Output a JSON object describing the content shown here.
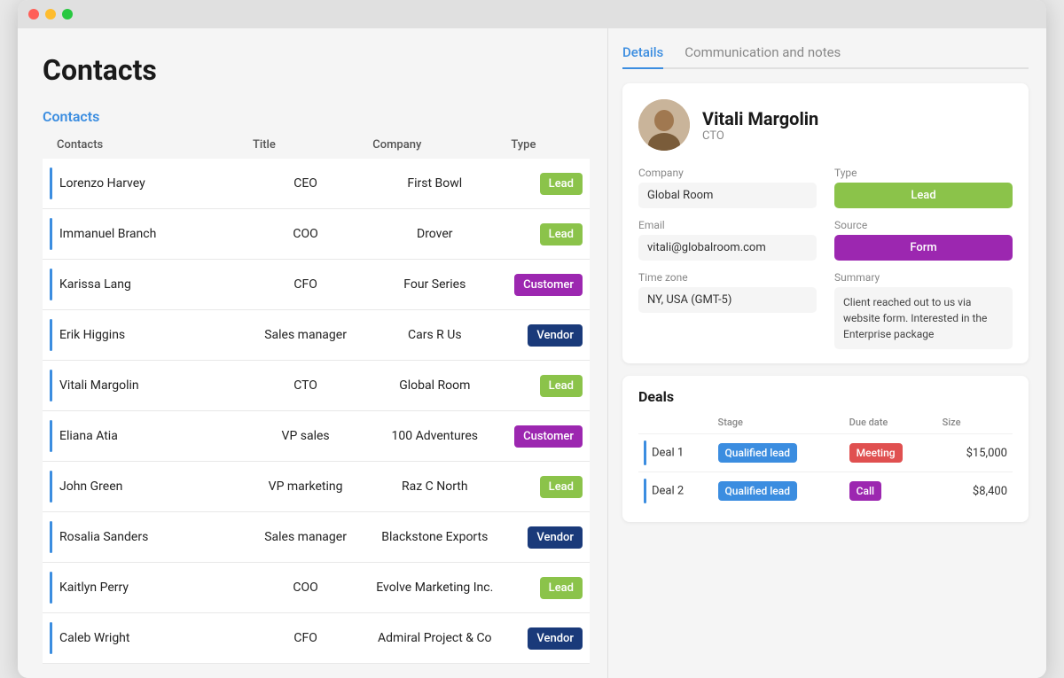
{
  "window": {
    "title": "Contacts"
  },
  "left": {
    "page_title": "Contacts",
    "section_title": "Contacts",
    "table": {
      "headers": [
        "Contacts",
        "Title",
        "Company",
        "Type"
      ],
      "rows": [
        {
          "name": "Lorenzo Harvey",
          "title": "CEO",
          "company": "First Bowl",
          "type": "Lead",
          "type_class": "lead"
        },
        {
          "name": "Immanuel Branch",
          "title": "COO",
          "company": "Drover",
          "type": "Lead",
          "type_class": "lead"
        },
        {
          "name": "Karissa Lang",
          "title": "CFO",
          "company": "Four Series",
          "type": "Customer",
          "type_class": "customer"
        },
        {
          "name": "Erik Higgins",
          "title": "Sales manager",
          "company": "Cars R Us",
          "type": "Vendor",
          "type_class": "vendor"
        },
        {
          "name": "Vitali Margolin",
          "title": "CTO",
          "company": "Global Room",
          "type": "Lead",
          "type_class": "lead"
        },
        {
          "name": "Eliana Atia",
          "title": "VP sales",
          "company": "100 Adventures",
          "type": "Customer",
          "type_class": "customer"
        },
        {
          "name": "John Green",
          "title": "VP marketing",
          "company": "Raz C North",
          "type": "Lead",
          "type_class": "lead"
        },
        {
          "name": "Rosalia Sanders",
          "title": "Sales manager",
          "company": "Blackstone Exports",
          "type": "Vendor",
          "type_class": "vendor"
        },
        {
          "name": "Kaitlyn Perry",
          "title": "COO",
          "company": "Evolve Marketing Inc.",
          "type": "Lead",
          "type_class": "lead"
        },
        {
          "name": "Caleb Wright",
          "title": "CFO",
          "company": "Admiral Project & Co",
          "type": "Vendor",
          "type_class": "vendor"
        }
      ]
    }
  },
  "right": {
    "tabs": [
      {
        "label": "Details",
        "active": true
      },
      {
        "label": "Communication and notes",
        "active": false
      }
    ],
    "detail": {
      "name": "Vitali Margolin",
      "role": "CTO",
      "company_label": "Company",
      "company_value": "Global Room",
      "type_label": "Type",
      "type_value": "Lead",
      "email_label": "Email",
      "email_value": "vitali@globalroom.com",
      "source_label": "Source",
      "source_value": "Form",
      "timezone_label": "Time zone",
      "timezone_value": "NY, USA (GMT-5)",
      "summary_label": "Summary",
      "summary_value": "Client reached out to us via website form. Interested in the Enterprise package"
    },
    "deals": {
      "title": "Deals",
      "headers": [
        "",
        "Stage",
        "Due date",
        "Size"
      ],
      "rows": [
        {
          "name": "Deal 1",
          "stage": "Qualified lead",
          "stage_class": "qualified",
          "due": "Meeting",
          "due_class": "meeting",
          "size": "$15,000"
        },
        {
          "name": "Deal 2",
          "stage": "Qualified lead",
          "stage_class": "qualified",
          "due": "Call",
          "due_class": "call",
          "size": "$8,400"
        }
      ]
    }
  }
}
